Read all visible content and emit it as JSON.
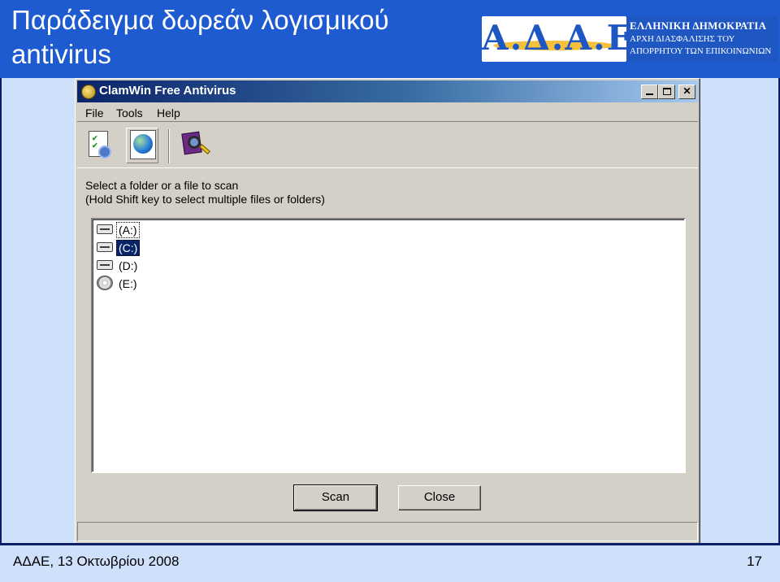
{
  "slide": {
    "title": "Παράδειγμα δωρεάν λογισμικού antivirus",
    "footer_left": "ΑΔΑΕ, 13 Οκτωβρίου 2008",
    "page_number": "17"
  },
  "logo": {
    "mark": "Α.Δ.Α.Ε.",
    "line1": "ΕΛΛΗΝΙΚΗ ΔΗΜΟΚΡΑΤΙΑ",
    "line2": "ΑΡΧΗ ΔΙΑΣΦΑΛΙΣΗΣ ΤΟΥ",
    "line3": "ΑΠΟΡΡΗΤΟΥ ΤΩΝ ΕΠΙΚΟΙΝΩΝΙΩΝ"
  },
  "window": {
    "title": "ClamWin Free Antivirus",
    "menu": {
      "file": "File",
      "tools": "Tools",
      "help": "Help"
    },
    "toolbar": {
      "icons": [
        "preferences-icon",
        "update-globe-icon",
        "scan-magnifier-icon"
      ]
    },
    "instructions": {
      "line1": "Select a folder or a file to scan",
      "line2": "(Hold Shift key to select multiple files or folders)"
    },
    "drives": [
      {
        "label": "(A:)",
        "icon": "floppy-drive-icon",
        "selected": false
      },
      {
        "label": "(C:)",
        "icon": "hard-drive-icon",
        "selected": true
      },
      {
        "label": "(D:)",
        "icon": "hard-drive-icon",
        "selected": false
      },
      {
        "label": "(E:)",
        "icon": "cd-drive-icon",
        "selected": false
      }
    ],
    "buttons": {
      "scan": "Scan",
      "close": "Close"
    }
  },
  "colors": {
    "header_blue": "#1f5bd0",
    "slide_bg": "#cfe0fb",
    "window_gray": "#d4d0c8",
    "title_bar": "#0a246a"
  }
}
